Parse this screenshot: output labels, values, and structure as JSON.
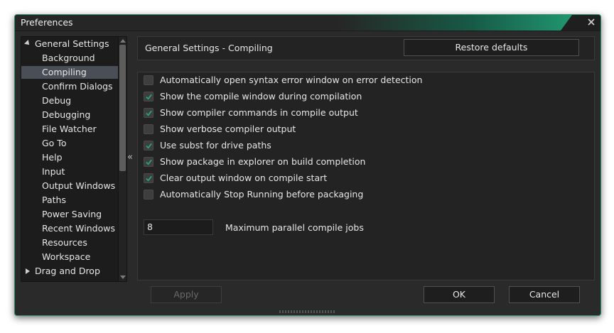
{
  "window": {
    "title": "Preferences"
  },
  "tree": {
    "items": [
      {
        "label": "General Settings",
        "type": "parent",
        "expanded": true,
        "selected": false
      },
      {
        "label": "Background",
        "type": "child",
        "selected": false
      },
      {
        "label": "Compiling",
        "type": "child",
        "selected": true
      },
      {
        "label": "Confirm Dialogs",
        "type": "child",
        "selected": false
      },
      {
        "label": "Debug",
        "type": "child",
        "selected": false
      },
      {
        "label": "Debugging",
        "type": "child",
        "selected": false
      },
      {
        "label": "File Watcher",
        "type": "child",
        "selected": false
      },
      {
        "label": "Go To",
        "type": "child",
        "selected": false
      },
      {
        "label": "Help",
        "type": "child",
        "selected": false
      },
      {
        "label": "Input",
        "type": "child",
        "selected": false
      },
      {
        "label": "Output Windows",
        "type": "child",
        "selected": false
      },
      {
        "label": "Paths",
        "type": "child",
        "selected": false
      },
      {
        "label": "Power Saving",
        "type": "child",
        "selected": false
      },
      {
        "label": "Recent Windows",
        "type": "child",
        "selected": false
      },
      {
        "label": "Resources",
        "type": "child",
        "selected": false
      },
      {
        "label": "Workspace",
        "type": "child",
        "selected": false
      },
      {
        "label": "Drag and Drop",
        "type": "parent",
        "expanded": false,
        "selected": false
      }
    ]
  },
  "header": {
    "title": "General Settings - Compiling",
    "restore_label": "Restore defaults"
  },
  "options": [
    {
      "label": "Automatically open syntax error window on error detection",
      "checked": false
    },
    {
      "label": "Show the compile window during compilation",
      "checked": true
    },
    {
      "label": "Show compiler commands in compile output",
      "checked": true
    },
    {
      "label": "Show verbose compiler output",
      "checked": false
    },
    {
      "label": "Use subst for drive paths",
      "checked": true
    },
    {
      "label": "Show package in explorer on build completion",
      "checked": true
    },
    {
      "label": "Clear output window on compile start",
      "checked": true
    },
    {
      "label": "Automatically Stop Running before packaging",
      "checked": false
    }
  ],
  "parallel_jobs": {
    "value": "8",
    "label": "Maximum parallel compile jobs"
  },
  "footer": {
    "apply_label": "Apply",
    "ok_label": "OK",
    "cancel_label": "Cancel"
  },
  "colors": {
    "accent": "#23a77b",
    "check": "#2aa37a",
    "selected_row": "#4a4f57"
  }
}
